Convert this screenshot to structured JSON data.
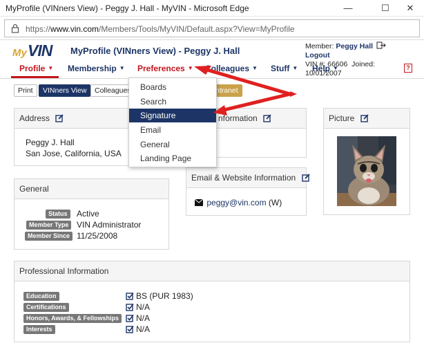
{
  "window": {
    "title": "MyProfile (VINners View) - Peggy J. Hall - MyVIN - Microsoft Edge"
  },
  "browser": {
    "url_prefix": "https://",
    "url_domain": "www.vin.com",
    "url_path": "/Members/Tools/MyVIN/Default.aspx?View=MyProfile"
  },
  "header": {
    "logo_my": "My",
    "logo_vin": "VIN",
    "title": "MyProfile (VINners View) - Peggy J. Hall",
    "member_label": "Member:",
    "member_name": "Peggy Hall",
    "logout": "Logout",
    "vin_label": "VIN #:",
    "vin_number": "66606",
    "joined_label": "Joined:",
    "joined_date": "10/01/2007"
  },
  "nav": {
    "profile": "Profile",
    "membership": "Membership",
    "preferences": "Preferences",
    "colleagues": "Colleagues",
    "stuff": "Stuff",
    "help": "Help",
    "help_icon": "?"
  },
  "subnav": {
    "print": "Print",
    "vinners_view": "VINners View",
    "colleagues_view": "Colleagues V",
    "intranet": "ntranet"
  },
  "dropdown": {
    "items": [
      "Boards",
      "Search",
      "Signature",
      "Email",
      "General",
      "Landing Page"
    ]
  },
  "address": {
    "title": "Address",
    "name": "Peggy J. Hall",
    "city": "San Jose, California, USA"
  },
  "contact": {
    "title": "nformation"
  },
  "email": {
    "title": "Email & Website Information",
    "address": "peggy@vin.com",
    "type": "(W)"
  },
  "picture": {
    "title": "Picture"
  },
  "general": {
    "title": "General",
    "rows": [
      {
        "label": "Status",
        "value": "Active"
      },
      {
        "label": "Member Type",
        "value": "VIN Administrator"
      },
      {
        "label": "Member Since",
        "value": "11/25/2008"
      }
    ]
  },
  "professional": {
    "title": "Professional Information",
    "rows": [
      {
        "label": "Education",
        "value": "BS (PUR 1983)"
      },
      {
        "label": "Certifications",
        "value": "N/A"
      },
      {
        "label": "Honors, Awards, & Fellowships",
        "value": "N/A"
      },
      {
        "label": "Interests",
        "value": "N/A"
      }
    ]
  },
  "colors": {
    "brand_navy": "#1d3566",
    "brand_red": "#c4151c",
    "gold": "#c9a24b",
    "arrow_red": "#e02020"
  }
}
